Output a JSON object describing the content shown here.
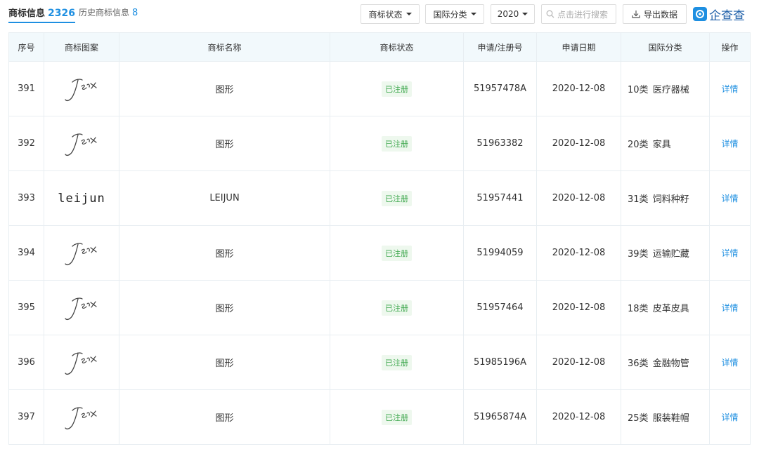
{
  "tabs": {
    "current": {
      "label": "商标信息",
      "count": "2326"
    },
    "history": {
      "label": "历史商标信息",
      "count": "8"
    }
  },
  "filters": {
    "status": "商标状态",
    "class": "国际分类",
    "year": "2020"
  },
  "search": {
    "placeholder": "点击进行搜索"
  },
  "export": {
    "label": "导出数据"
  },
  "logo": {
    "text": "企查查"
  },
  "columns": [
    "序号",
    "商标图案",
    "商标名称",
    "商标状态",
    "申请/注册号",
    "申请日期",
    "国际分类",
    "操作"
  ],
  "rows": [
    {
      "index": "391",
      "image": "signature",
      "name": "图形",
      "status": "已注册",
      "reg_no": "51957478A",
      "date": "2020-12-08",
      "class_no": "10类",
      "class_name": "医疗器械",
      "action": "详情"
    },
    {
      "index": "392",
      "image": "signature",
      "name": "图形",
      "status": "已注册",
      "reg_no": "51963382",
      "date": "2020-12-08",
      "class_no": "20类",
      "class_name": "家具",
      "action": "详情"
    },
    {
      "index": "393",
      "image": "wordmark",
      "wordmark": "leijun",
      "name": "LEIJUN",
      "status": "已注册",
      "reg_no": "51957441",
      "date": "2020-12-08",
      "class_no": "31类",
      "class_name": "饲料种籽",
      "action": "详情"
    },
    {
      "index": "394",
      "image": "signature",
      "name": "图形",
      "status": "已注册",
      "reg_no": "51994059",
      "date": "2020-12-08",
      "class_no": "39类",
      "class_name": "运输贮藏",
      "action": "详情"
    },
    {
      "index": "395",
      "image": "signature",
      "name": "图形",
      "status": "已注册",
      "reg_no": "51957464",
      "date": "2020-12-08",
      "class_no": "18类",
      "class_name": "皮革皮具",
      "action": "详情"
    },
    {
      "index": "396",
      "image": "signature",
      "name": "图形",
      "status": "已注册",
      "reg_no": "51985196A",
      "date": "2020-12-08",
      "class_no": "36类",
      "class_name": "金融物管",
      "action": "详情"
    },
    {
      "index": "397",
      "image": "signature",
      "name": "图形",
      "status": "已注册",
      "reg_no": "51965874A",
      "date": "2020-12-08",
      "class_no": "25类",
      "class_name": "服装鞋帽",
      "action": "详情"
    }
  ],
  "colors": {
    "accent": "#1e8fe1",
    "header_bg": "#f2f9fc",
    "status_green": "#3ba64b"
  }
}
